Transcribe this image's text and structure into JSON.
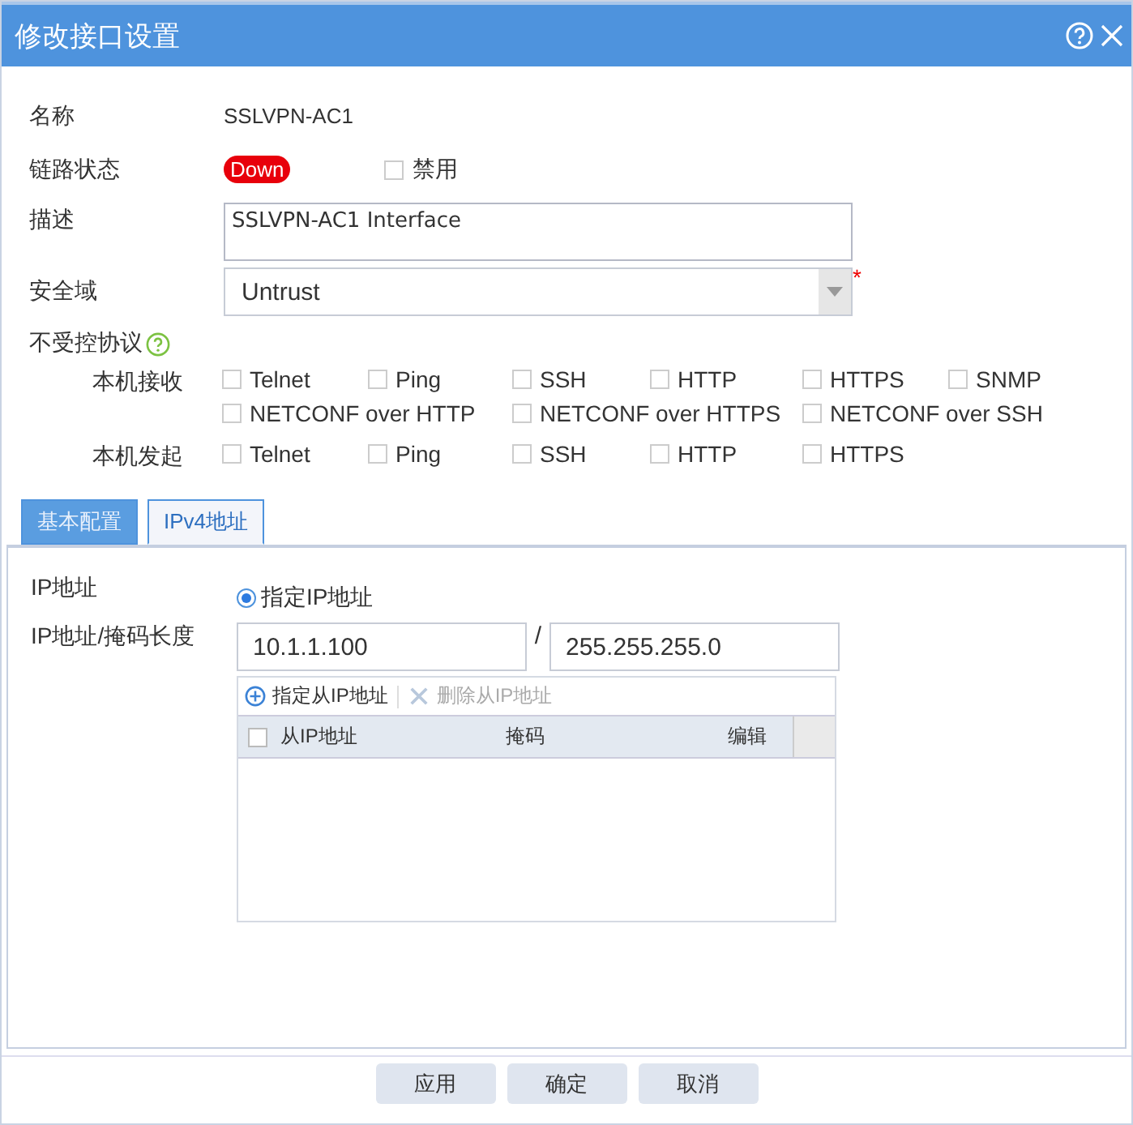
{
  "window": {
    "title": "修改接口设置"
  },
  "name": {
    "label": "名称",
    "value": "SSLVPN-AC1"
  },
  "link_status": {
    "label": "链路状态",
    "status": "Down",
    "disable": {
      "label": "禁用",
      "checked": false
    }
  },
  "description": {
    "label": "描述",
    "value": "SSLVPN-AC1 Interface"
  },
  "security_zone": {
    "label": "安全域",
    "value": "Untrust",
    "required_mark": "*"
  },
  "uncontrolled_protocols": {
    "label": "不受控协议",
    "groups": [
      {
        "label": "本机接收",
        "items": [
          {
            "label": "Telnet",
            "checked": false
          },
          {
            "label": "Ping",
            "checked": false
          },
          {
            "label": "SSH",
            "checked": false
          },
          {
            "label": "HTTP",
            "checked": false
          },
          {
            "label": "HTTPS",
            "checked": false
          },
          {
            "label": "SNMP",
            "checked": false
          },
          {
            "label": "NETCONF over HTTP",
            "checked": false
          },
          {
            "label": "NETCONF over HTTPS",
            "checked": false
          },
          {
            "label": "NETCONF over SSH",
            "checked": false
          }
        ]
      },
      {
        "label": "本机发起",
        "items": [
          {
            "label": "Telnet",
            "checked": false
          },
          {
            "label": "Ping",
            "checked": false
          },
          {
            "label": "SSH",
            "checked": false
          },
          {
            "label": "HTTP",
            "checked": false
          },
          {
            "label": "HTTPS",
            "checked": false
          }
        ]
      }
    ]
  },
  "tabs": [
    {
      "label": "基本配置",
      "selected": false
    },
    {
      "label": "IPv4地址",
      "selected": true
    }
  ],
  "ipv4": {
    "address_label": "IP地址",
    "mode_option": {
      "label": "指定IP地址",
      "selected": true
    },
    "address_mask_label": "IP地址/掩码长度",
    "address": "10.1.1.100",
    "separator": "/",
    "mask": "255.255.255.0",
    "toolbar": [
      {
        "kind": "add",
        "label": "指定从IP地址",
        "disabled": false
      },
      {
        "kind": "delete",
        "label": "删除从IP地址",
        "disabled": true
      }
    ],
    "table": {
      "select_all_checked": false,
      "columns": [
        "从IP地址",
        "掩码",
        "编辑"
      ]
    }
  },
  "buttons": [
    "应用",
    "确定",
    "取消"
  ]
}
